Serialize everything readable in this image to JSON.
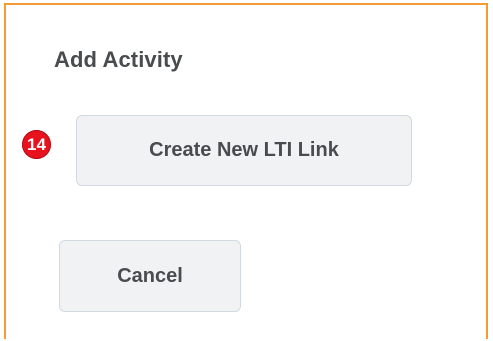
{
  "dialog": {
    "title": "Add Activity",
    "step_badge": "14",
    "create_button_label": "Create New LTI Link",
    "cancel_button_label": "Cancel"
  },
  "colors": {
    "frame_border": "#f29a33",
    "badge": "#e8121f",
    "button_bg": "#f1f2f4",
    "button_border": "#d3d9e3",
    "text": "#494c4e"
  }
}
